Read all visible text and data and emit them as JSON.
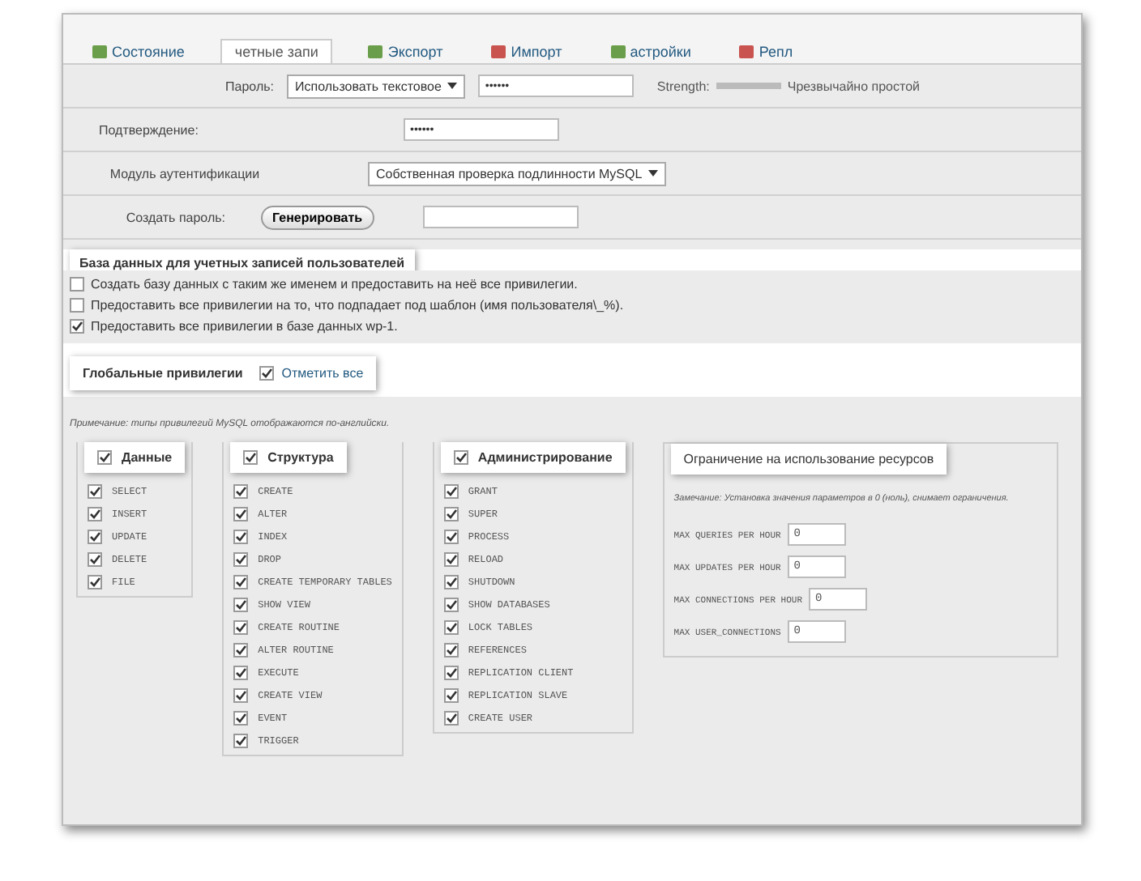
{
  "tabs": [
    {
      "label": "Состояние",
      "selected": false
    },
    {
      "label": "четные запи",
      "selected": true
    },
    {
      "label": "Экспорт",
      "selected": false
    },
    {
      "label": "Импорт",
      "selected": false
    },
    {
      "label": "астройки",
      "selected": false
    },
    {
      "label": "Репл",
      "selected": false
    }
  ],
  "login": {
    "password_label": "Пароль:",
    "password_mode": "Использовать текстовое",
    "password_value": "••••••",
    "strength_label": "Strength:",
    "strength_text": "Чрезвычайно простой",
    "confirm_label": "Подтверждение:",
    "confirm_value": "••••••",
    "auth_label": "Модуль аутентификации",
    "auth_value": "Собственная проверка подлинности MySQL",
    "generate_label": "Создать пароль:",
    "generate_button": "Генерировать"
  },
  "database": {
    "title": "База данных для учетных записей пользователей",
    "options": [
      {
        "label": "Создать базу данных с таким же именем и предоставить на неё все привилегии.",
        "checked": false
      },
      {
        "label": "Предоставить все привилегии на то, что подпадает под шаблон (имя пользователя\\_%).",
        "checked": false
      },
      {
        "label": "Предоставить все привилегии в базе данных wp-1.",
        "checked": true
      }
    ]
  },
  "global": {
    "title": "Глобальные привилегии",
    "check_all": "Отметить все",
    "check_all_checked": true,
    "note": "Примечание: типы привилегий MySQL отображаются по-английски.",
    "groups": [
      {
        "title": "Данные",
        "checked": true,
        "items": [
          {
            "label": "SELECT",
            "checked": true
          },
          {
            "label": "INSERT",
            "checked": true
          },
          {
            "label": "UPDATE",
            "checked": true
          },
          {
            "label": "DELETE",
            "checked": true
          },
          {
            "label": "FILE",
            "checked": true
          }
        ]
      },
      {
        "title": "Структура",
        "checked": true,
        "items": [
          {
            "label": "CREATE",
            "checked": true
          },
          {
            "label": "ALTER",
            "checked": true
          },
          {
            "label": "INDEX",
            "checked": true
          },
          {
            "label": "DROP",
            "checked": true
          },
          {
            "label": "CREATE TEMPORARY TABLES",
            "checked": true
          },
          {
            "label": "SHOW VIEW",
            "checked": true
          },
          {
            "label": "CREATE ROUTINE",
            "checked": true
          },
          {
            "label": "ALTER ROUTINE",
            "checked": true
          },
          {
            "label": "EXECUTE",
            "checked": true
          },
          {
            "label": "CREATE VIEW",
            "checked": true
          },
          {
            "label": "EVENT",
            "checked": true
          },
          {
            "label": "TRIGGER",
            "checked": true
          }
        ]
      },
      {
        "title": "Администрирование",
        "checked": true,
        "items": [
          {
            "label": "GRANT",
            "checked": true
          },
          {
            "label": "SUPER",
            "checked": true
          },
          {
            "label": "PROCESS",
            "checked": true
          },
          {
            "label": "RELOAD",
            "checked": true
          },
          {
            "label": "SHUTDOWN",
            "checked": true
          },
          {
            "label": "SHOW DATABASES",
            "checked": true
          },
          {
            "label": "LOCK TABLES",
            "checked": true
          },
          {
            "label": "REFERENCES",
            "checked": true
          },
          {
            "label": "REPLICATION CLIENT",
            "checked": true
          },
          {
            "label": "REPLICATION SLAVE",
            "checked": true
          },
          {
            "label": "CREATE USER",
            "checked": true
          }
        ]
      }
    ],
    "limits": {
      "title": "Ограничение на использование ресурсов",
      "note": "Замечание: Установка значения параметров в 0 (ноль), снимает ограничения.",
      "fields": [
        {
          "label": "MAX QUERIES PER HOUR",
          "value": "0"
        },
        {
          "label": "MAX UPDATES PER HOUR",
          "value": "0"
        },
        {
          "label": "MAX CONNECTIONS PER HOUR",
          "value": "0"
        },
        {
          "label": "MAX USER_CONNECTIONS",
          "value": "0"
        }
      ]
    }
  }
}
